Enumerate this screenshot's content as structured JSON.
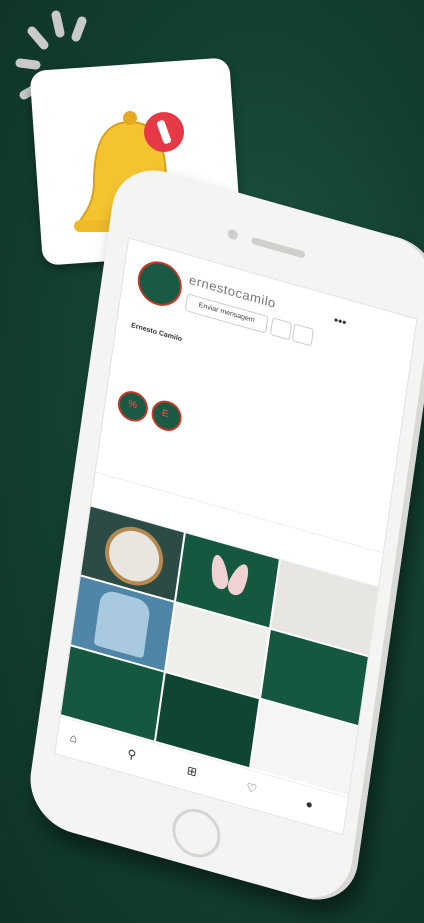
{
  "profile": {
    "username": "ernestocamilo",
    "message_button": "Enviar mensagem",
    "follow_button": "",
    "more_button": "",
    "name": "Ernesto Camilo",
    "bio_line1": "",
    "bio_line2": "",
    "bio_link": "",
    "follows_text": ""
  },
  "tabs": {
    "posts": "",
    "reels": "",
    "tagged": ""
  },
  "grid": {
    "cell5_text": "",
    "cell9_text": ""
  },
  "bottom_nav": {
    "follow_cta": "",
    "icons": [
      "home-icon",
      "search-icon",
      "add-post-icon",
      "heart-icon",
      "profile-icon"
    ]
  },
  "notification": {
    "badge_text": "!",
    "bell_color": "#f4c430",
    "badge_color": "#e63946"
  },
  "colors": {
    "background": "#14402f",
    "brand_green": "#15573f"
  }
}
